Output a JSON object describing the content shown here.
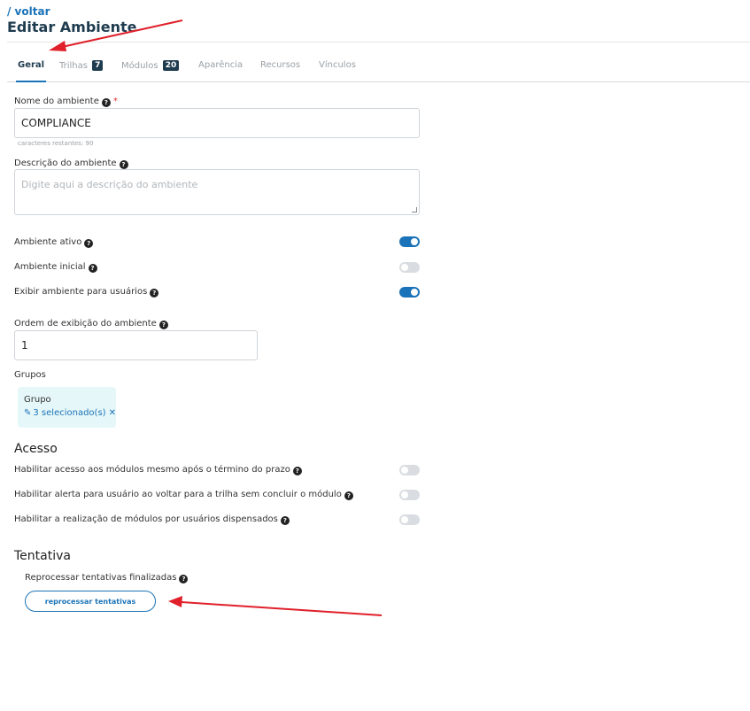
{
  "header": {
    "back_label": "/ voltar",
    "title": "Editar Ambiente"
  },
  "tabs": [
    {
      "label": "Geral",
      "badge": ""
    },
    {
      "label": "Trilhas",
      "badge": "7"
    },
    {
      "label": "Módulos",
      "badge": "20"
    },
    {
      "label": "Aparência",
      "badge": ""
    },
    {
      "label": "Recursos",
      "badge": ""
    },
    {
      "label": "Vínculos",
      "badge": ""
    }
  ],
  "form": {
    "name_label": "Nome do ambiente",
    "name_required_mark": "*",
    "name_value": "COMPLIANCE",
    "name_hint": "caracteres restantes: 90",
    "description_label": "Descrição do ambiente",
    "description_placeholder": "Digite aqui a descrição do ambiente",
    "toggles": [
      {
        "label": "Ambiente ativo",
        "on": true
      },
      {
        "label": "Ambiente inicial",
        "on": false
      },
      {
        "label": "Exibir ambiente para usuários",
        "on": true
      }
    ],
    "order_label": "Ordem de exibição do ambiente",
    "order_value": "1",
    "groups_label": "Grupos",
    "group_card": {
      "title": "Grupo",
      "selection": "3 selecionado(s)"
    }
  },
  "access": {
    "title": "Acesso",
    "toggles": [
      {
        "label": "Habilitar acesso aos módulos mesmo após o término do prazo",
        "on": false
      },
      {
        "label": "Habilitar alerta para usuário ao voltar para a trilha sem concluir o módulo",
        "on": false
      },
      {
        "label": "Habilitar a realização de módulos por usuários dispensados",
        "on": false
      }
    ]
  },
  "attempt": {
    "title": "Tentativa",
    "reprocess_label": "Reprocessar tentativas finalizadas",
    "reprocess_button": "reprocessar tentativas"
  },
  "colors": {
    "accent": "#1a73b8",
    "title": "#1f3c4f",
    "annotation_arrow": "#e0202a",
    "group_card_bg": "#e6f7f9"
  }
}
